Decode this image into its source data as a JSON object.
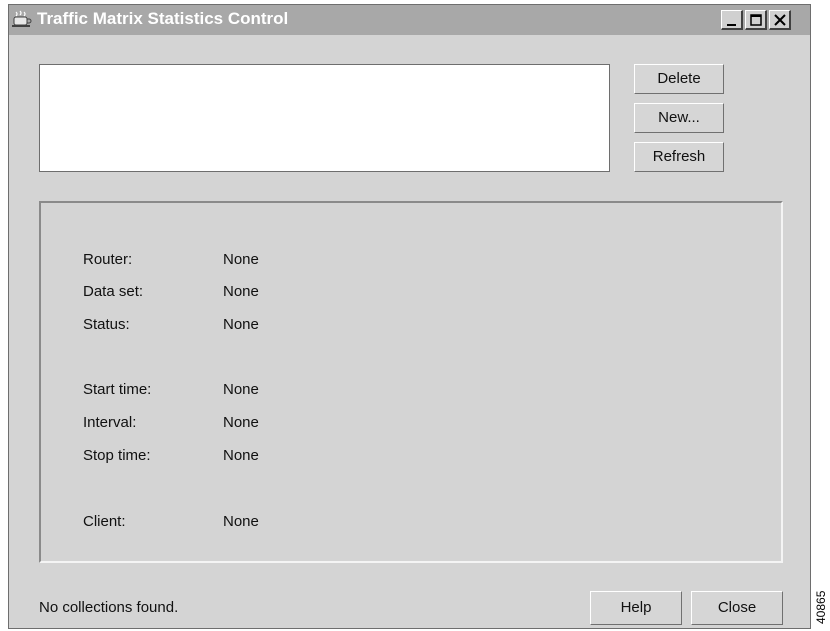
{
  "window": {
    "title": "Traffic Matrix Statistics Control",
    "controls": {
      "minimize": "_",
      "maximize": "□",
      "close": "×"
    }
  },
  "actions": {
    "delete_label": "Delete",
    "new_label": "New...",
    "refresh_label": "Refresh"
  },
  "details": {
    "rows": [
      {
        "label": "Router:",
        "value": "None"
      },
      {
        "label": "Data set:",
        "value": "None"
      },
      {
        "label": "Status:",
        "value": "None"
      },
      {
        "label": "Start time:",
        "value": "None"
      },
      {
        "label": "Interval:",
        "value": "None"
      },
      {
        "label": "Stop time:",
        "value": "None"
      },
      {
        "label": "Client:",
        "value": "None"
      }
    ]
  },
  "footer": {
    "status_text": "No collections found.",
    "help_label": "Help",
    "close_label": "Close"
  },
  "figure_id": "40865",
  "icons": {
    "app": "coffee-cup-icon",
    "minimize": "minimize-icon",
    "maximize": "maximize-icon",
    "close": "close-icon"
  }
}
